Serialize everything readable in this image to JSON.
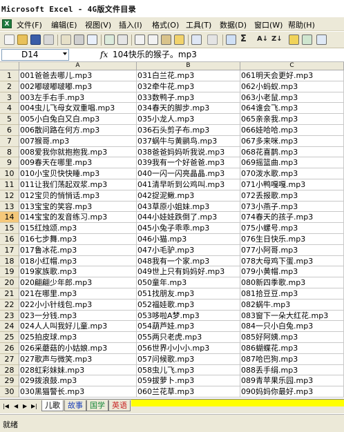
{
  "window": {
    "title": "Microsoft Excel - 4G版文件目录"
  },
  "menu": {
    "icon_label": "X",
    "items": [
      "文件(F)",
      "编辑(E)",
      "视图(V)",
      "插入(I)",
      "格式(O)",
      "工具(T)",
      "数据(D)",
      "窗口(W)",
      "帮助(H)"
    ]
  },
  "toolbar": {
    "sigma": "Σ",
    "sort_asc": "A↓",
    "sort_desc": "Z↓",
    "icon_names": [
      "new-icon",
      "open-icon",
      "save-icon",
      "permission-icon",
      "email-icon",
      "print-icon",
      "print-preview-icon",
      "spellcheck-icon",
      "research-icon",
      "cut-icon",
      "copy-icon",
      "paste-icon",
      "format-painter-icon",
      "undo-icon",
      "redo-icon",
      "hyperlink-icon",
      "chart-wizard-icon",
      "drawing-icon",
      "zoom-icon"
    ]
  },
  "formula_bar": {
    "name_box": "D14",
    "fx": "fx",
    "value": "104快乐的猴子。mp3"
  },
  "grid": {
    "column_headers": [
      "A",
      "B",
      "C"
    ],
    "active_row": 14,
    "rows": [
      {
        "n": "1",
        "a": "001爸爸去哪儿.mp3",
        "b": "031白兰花.mp3",
        "c": "061明天会更好.mp3"
      },
      {
        "n": "2",
        "a": "002嘟啵嘟啵嘟.mp3",
        "b": "032牵牛花.mp3",
        "c": "062小蚂蚁.mp3"
      },
      {
        "n": "3",
        "a": "003左手右手.mp3",
        "b": "033数鸭子.mp3",
        "c": "063小老鼠.mp3"
      },
      {
        "n": "4",
        "a": "004虫儿飞母女双重唱.mp3",
        "b": "034春天的脚步.mp3",
        "c": "064谁会飞.mp3"
      },
      {
        "n": "5",
        "a": "005小白兔白又白.mp3",
        "b": "035小龙人.mp3",
        "c": "065亲亲我.mp3"
      },
      {
        "n": "6",
        "a": "006散问路在何方.mp3",
        "b": "036石头剪子布.mp3",
        "c": "066娃哈哈.mp3"
      },
      {
        "n": "7",
        "a": "007猴哥.mp3",
        "b": "037蜗牛与黄鹂鸟.mp3",
        "c": "067多来咪.mp3"
      },
      {
        "n": "8",
        "a": "008爱我你就抱抱我.mp3",
        "b": "038爸爸妈妈听我说.mp3",
        "c": "068花喜鹊.mp3"
      },
      {
        "n": "9",
        "a": "009春天在哪里.mp3",
        "b": "039我有一个好爸爸.mp3",
        "c": "069摇篮曲.mp3"
      },
      {
        "n": "10",
        "a": "010小宝贝快快睡.mp3",
        "b": "040一闪一闪亮晶晶.mp3",
        "c": "070泼水歌.mp3"
      },
      {
        "n": "11",
        "a": "011让我们荡起双浆.mp3",
        "b": "041清早听到公鸡叫.mp3",
        "c": "071小鸭嘎嘎.mp3"
      },
      {
        "n": "12",
        "a": "012宝贝的悄悄话.mp3",
        "b": "042捉泥鳅.mp3",
        "c": "072丢报歌.mp3"
      },
      {
        "n": "13",
        "a": "013宝宝的笑容.mp3",
        "b": "043草原小姐妹.mp3",
        "c": "073小燕子.mp3"
      },
      {
        "n": "14",
        "a": "014宝宝的发音练习.mp3",
        "b": "044小娃娃跌倒了.mp3",
        "c": "074春天的孩子.mp3"
      },
      {
        "n": "15",
        "a": "015红烛颂.mp3",
        "b": "045小兔子乖乖.mp3",
        "c": "075小螺号.mp3"
      },
      {
        "n": "16",
        "a": "016七步舞.mp3",
        "b": "046小猫.mp3",
        "c": "076生日快乐.mp3"
      },
      {
        "n": "17",
        "a": "017鲁冰花.mp3",
        "b": "047小毛驴.mp3",
        "c": "077小阿哥.mp3"
      },
      {
        "n": "18",
        "a": "018小红帽.mp3",
        "b": "048我有一个家.mp3",
        "c": "078大母鸡下蛋.mp3"
      },
      {
        "n": "19",
        "a": "019家族歌.mp3",
        "b": "049世上只有妈妈好.mp3",
        "c": "079小黄帽.mp3"
      },
      {
        "n": "20",
        "a": "020翩翩少年郎.mp3",
        "b": "050童年.mp3",
        "c": "080新四季歌.mp3"
      },
      {
        "n": "21",
        "a": "021在哪里.mp3",
        "b": "051找朋友.mp3",
        "c": "081拾豆豆.mp3"
      },
      {
        "n": "22",
        "a": "022小小针线包.mp3",
        "b": "052福娃歌.mp3",
        "c": "082蜗牛.mp3"
      },
      {
        "n": "23",
        "a": "023一分钱.mp3",
        "b": "053哆啦A梦.mp3",
        "c": "083窗下一朵大红花.mp3"
      },
      {
        "n": "24",
        "a": "024人人叫我好儿童.mp3",
        "b": "054葫芦娃.mp3",
        "c": "084一只小白兔.mp3"
      },
      {
        "n": "25",
        "a": "025拍皮球.mp3",
        "b": "055两只老虎.mp3",
        "c": "085好阿姨.mp3"
      },
      {
        "n": "26",
        "a": "026采蘑菇的小姑娘.mp3",
        "b": "056世界小小小.mp3",
        "c": "086蝴蝶花.mp3"
      },
      {
        "n": "27",
        "a": "027歌声与微笑.mp3",
        "b": "057问候歌.mp3",
        "c": "087哈巴狗.mp3"
      },
      {
        "n": "28",
        "a": "028虹彩妹妹.mp3",
        "b": "058虫儿飞.mp3",
        "c": "088丢手绢.mp3"
      },
      {
        "n": "29",
        "a": "029拨浪鼓.mp3",
        "b": "059拔萝卜.mp3",
        "c": "089青苹果乐园.mp3"
      },
      {
        "n": "30",
        "a": "030黑猫警长.mp3",
        "b": "060兰花草.mp3",
        "c": "090妈妈你最好.mp3"
      }
    ]
  },
  "sheets": {
    "nav": [
      "|◀",
      "◀",
      "▶",
      "▶|"
    ],
    "tabs": [
      "儿歌",
      "故事",
      "国学",
      "英语"
    ],
    "active": "儿歌"
  },
  "status": {
    "text": "就绪"
  }
}
